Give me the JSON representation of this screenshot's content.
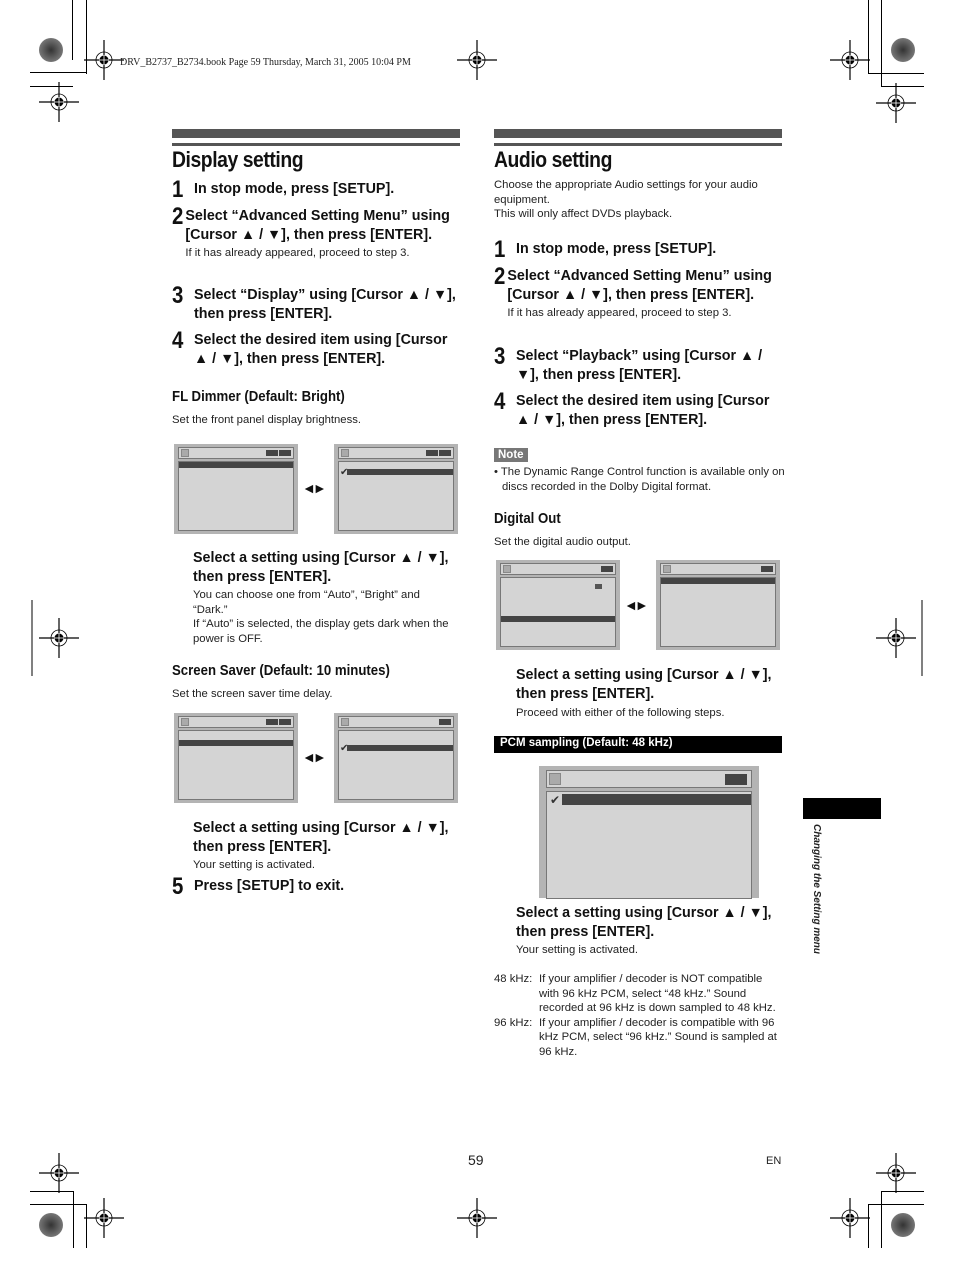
{
  "header": {
    "print_info": "DRV_B2737_B2734.book  Page 59  Thursday, March 31, 2005  10:04 PM"
  },
  "display_section": {
    "title": "Display setting",
    "steps": [
      {
        "num": "1",
        "text": "In stop mode, press [SETUP]."
      },
      {
        "num": "2",
        "text": "Select “Advanced Setting Menu” using [Cursor ▲ / ▼], then press [ENTER].",
        "note": "If it has already appeared, proceed to step 3."
      },
      {
        "num": "3",
        "text": "Select “Display” using [Cursor ▲ / ▼], then press [ENTER]."
      },
      {
        "num": "4",
        "text": "Select the desired item using [Cursor ▲ / ▼], then press [ENTER]."
      }
    ],
    "fl_dimmer": {
      "title": "FL Dimmer (Default: Bright)",
      "desc": "Set the front panel display brightness.",
      "instruction": "Select a setting using [Cursor ▲ / ▼], then press [ENTER].",
      "note1": "You can choose one from “Auto”, “Bright” and “Dark.”",
      "note2": "If “Auto” is selected, the display gets dark when the power is OFF."
    },
    "screen_saver": {
      "title": "Screen Saver (Default: 10 minutes)",
      "desc": "Set the screen saver time delay.",
      "instruction": "Select a setting using [Cursor ▲ / ▼], then press [ENTER].",
      "note": "Your setting is activated."
    },
    "step5": {
      "num": "5",
      "text": "Press [SETUP] to exit."
    }
  },
  "audio_section": {
    "title": "Audio setting",
    "intro1": "Choose the appropriate Audio settings for your audio equipment.",
    "intro2": "This will only affect DVDs playback.",
    "steps": [
      {
        "num": "1",
        "text": "In stop mode, press [SETUP]."
      },
      {
        "num": "2",
        "text": "Select “Advanced Setting Menu” using [Cursor ▲ / ▼], then press [ENTER].",
        "note": "If it has already appeared, proceed to step 3."
      },
      {
        "num": "3",
        "text": "Select “Playback” using [Cursor ▲ / ▼], then press [ENTER]."
      },
      {
        "num": "4",
        "text": "Select the desired item using [Cursor ▲ / ▼], then press [ENTER]."
      }
    ],
    "note_label": "Note",
    "note_text": "• The Dynamic Range Control function is available only on discs recorded in the Dolby Digital format.",
    "digital_out": {
      "title": "Digital Out",
      "desc": "Set the digital audio output.",
      "instruction": "Select a setting using [Cursor ▲ / ▼], then press [ENTER].",
      "note": "Proceed with either of the following steps."
    },
    "pcm": {
      "bar": "PCM sampling (Default: 48 kHz)",
      "instruction": "Select a setting using [Cursor ▲ / ▼], then press [ENTER].",
      "note": "Your setting is activated.",
      "options": [
        {
          "term": "48 kHz:",
          "desc": "If your amplifier / decoder is NOT compatible with 96 kHz PCM, select “48 kHz.” Sound recorded at 96 kHz is down sampled to 48 kHz."
        },
        {
          "term": "96 kHz:",
          "desc": "If your amplifier / decoder is compatible with 96 kHz PCM, select “96 kHz.” Sound is sampled at 96 kHz."
        }
      ]
    }
  },
  "side_tab": {
    "label": "Changing the Setting menu"
  },
  "footer": {
    "page_number": "59",
    "language": "EN"
  },
  "icons": {
    "double_arrow": "◄►",
    "check": "✔"
  }
}
